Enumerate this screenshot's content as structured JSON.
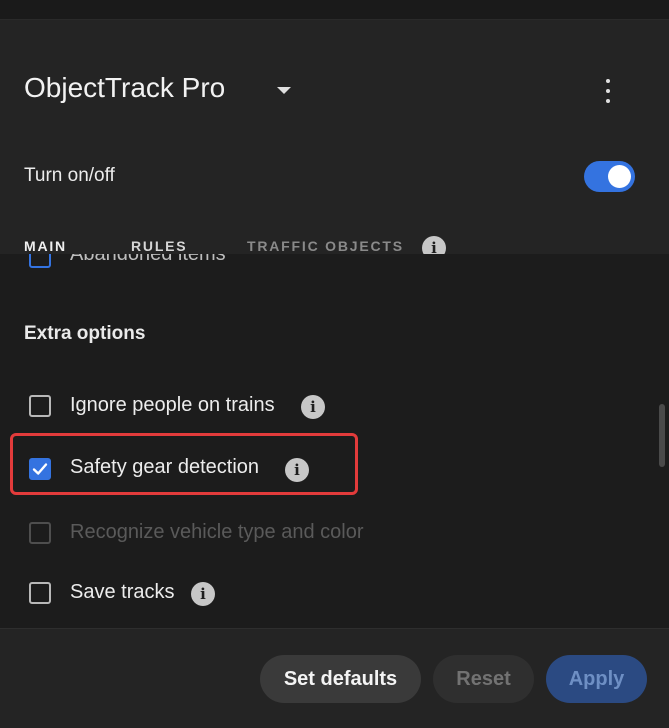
{
  "app": {
    "title": "ObjectTrack Pro"
  },
  "toggle": {
    "label": "Turn on/off",
    "on": true
  },
  "tabs": [
    {
      "label": "MAIN",
      "active": true
    },
    {
      "label": "RULES",
      "active": false
    },
    {
      "label": "TRAFFIC OBJECTS",
      "active": false,
      "disabled": true
    }
  ],
  "content": {
    "partial_item": "Abandoned items",
    "section_title": "Extra options",
    "options": [
      {
        "label": "Ignore people on trains",
        "checked": false,
        "disabled": false,
        "info": true
      },
      {
        "label": "Safety gear detection",
        "checked": true,
        "disabled": false,
        "info": true,
        "highlighted": true
      },
      {
        "label": "Recognize vehicle type and color",
        "checked": false,
        "disabled": true,
        "info": false
      },
      {
        "label": "Save tracks",
        "checked": false,
        "disabled": false,
        "info": true
      }
    ]
  },
  "footer": {
    "defaults_label": "Set defaults",
    "reset_label": "Reset",
    "apply_label": "Apply"
  },
  "icons": {
    "info_glyph": "i"
  },
  "colors": {
    "accent": "#3473e0",
    "highlight_border": "#e23b3b"
  }
}
